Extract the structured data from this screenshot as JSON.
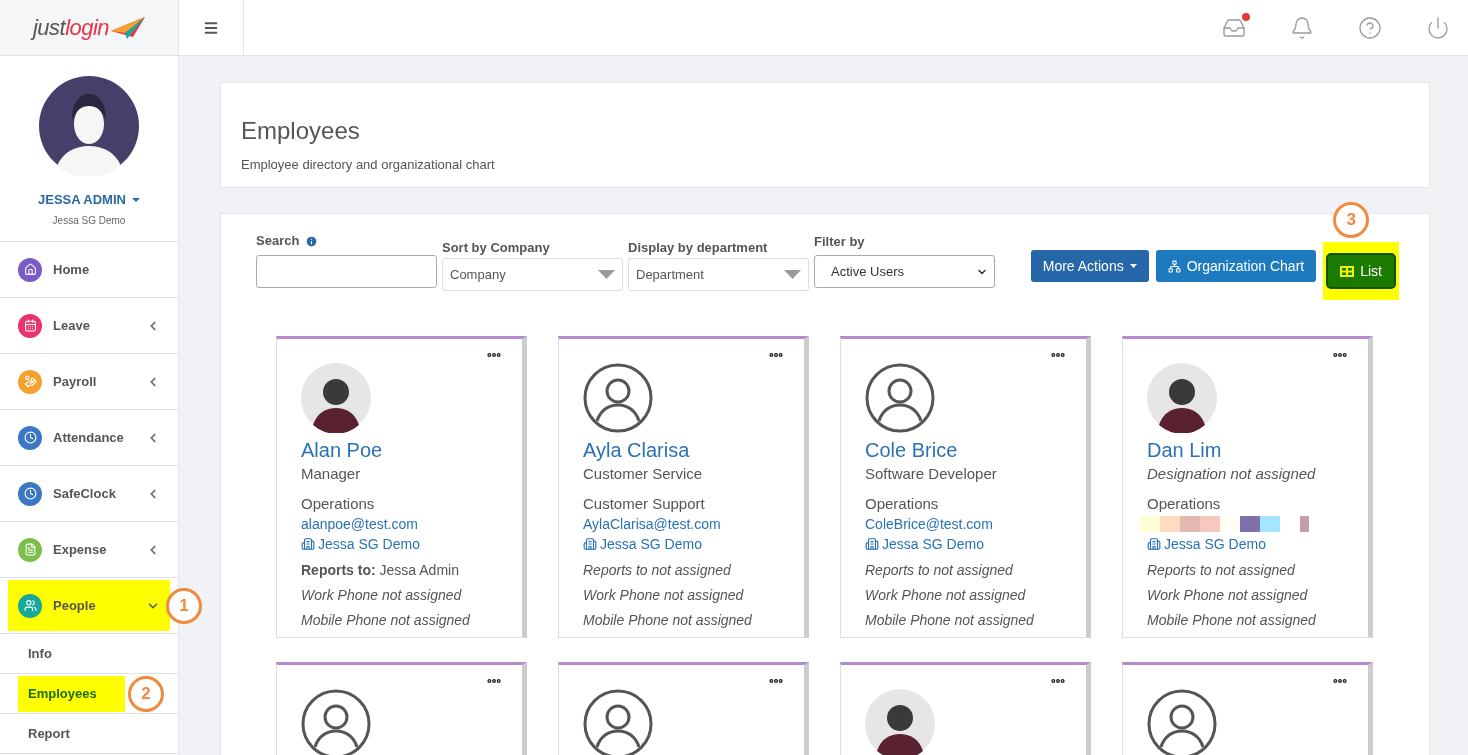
{
  "logo": {
    "part_1": "just",
    "part_2": "login"
  },
  "topbar": {
    "inbox_unread": true
  },
  "profile": {
    "name": "JESSA ADMIN",
    "company": "Jessa SG Demo"
  },
  "nav": [
    {
      "label": "Home",
      "color": "#7b5cc7",
      "expandable": false,
      "highlighted": false
    },
    {
      "label": "Leave",
      "color": "#e8336d",
      "expandable": true,
      "expanded": false,
      "highlighted": false
    },
    {
      "label": "Payroll",
      "color": "#f4a12d",
      "expandable": true,
      "expanded": false,
      "highlighted": false
    },
    {
      "label": "Attendance",
      "color": "#3a78c3",
      "expandable": true,
      "expanded": false,
      "highlighted": false
    },
    {
      "label": "SafeClock",
      "color": "#3a78c3",
      "expandable": true,
      "expanded": false,
      "highlighted": false
    },
    {
      "label": "Expense",
      "color": "#7cbf4a",
      "expandable": true,
      "expanded": false,
      "highlighted": false
    },
    {
      "label": "People",
      "color": "#19a99b",
      "expandable": true,
      "expanded": true,
      "highlighted": true,
      "callout": "1",
      "children": [
        {
          "label": "Info",
          "selected": false
        },
        {
          "label": "Employees",
          "selected": true,
          "callout": "2"
        },
        {
          "label": "Report",
          "selected": false
        }
      ]
    }
  ],
  "page": {
    "title": "Employees",
    "subtitle": "Employee directory and organizational chart"
  },
  "filters": {
    "search": {
      "label": "Search"
    },
    "sort": {
      "label": "Sort by Company",
      "value": "Company"
    },
    "department": {
      "label": "Display by department",
      "value": "Department"
    },
    "filter": {
      "label": "Filter by",
      "value": "Active Users"
    }
  },
  "actions": [
    {
      "label": "More Actions",
      "kind": "dropdown",
      "selected": false
    },
    {
      "label": "Organization Chart",
      "kind": "orgchart",
      "selected": false
    },
    {
      "label": "List",
      "kind": "list",
      "selected": true,
      "callout": "3"
    }
  ],
  "employees": [
    {
      "avatar": {
        "kind": "photo"
      },
      "name": "Alan Poe",
      "lines": [
        {
          "kind": "title",
          "text": "Manager",
          "italic": false
        },
        {
          "kind": "dept",
          "text": "Operations",
          "italic": false
        },
        {
          "kind": "email",
          "text": "alanpoe@test.com"
        },
        {
          "kind": "company",
          "text": "Jessa SG Demo"
        },
        {
          "kind": "plain",
          "text": "**Reports to:** Jessa Admin",
          "italic": false
        },
        {
          "kind": "plain",
          "text": "Work Phone not assigned",
          "italic": true
        },
        {
          "kind": "plain",
          "text": "Mobile Phone not assigned",
          "italic": true
        }
      ]
    },
    {
      "avatar": {
        "kind": "default"
      },
      "name": "Ayla Clarisa",
      "lines": [
        {
          "kind": "title",
          "text": "Customer Service",
          "italic": false
        },
        {
          "kind": "dept",
          "text": "Customer Support",
          "italic": false
        },
        {
          "kind": "email",
          "text": "AylaClarisa@test.com"
        },
        {
          "kind": "company",
          "text": "Jessa SG Demo"
        },
        {
          "kind": "plain",
          "text": "Reports to not assigned",
          "italic": true
        },
        {
          "kind": "plain",
          "text": "Work Phone not assigned",
          "italic": true
        },
        {
          "kind": "plain",
          "text": "Mobile Phone not assigned",
          "italic": true
        }
      ]
    },
    {
      "avatar": {
        "kind": "default"
      },
      "name": "Cole Brice",
      "lines": [
        {
          "kind": "title",
          "text": "Software Developer",
          "italic": false
        },
        {
          "kind": "dept",
          "text": "Operations",
          "italic": false
        },
        {
          "kind": "email",
          "text": "ColeBrice@test.com"
        },
        {
          "kind": "company",
          "text": "Jessa SG Demo"
        },
        {
          "kind": "plain",
          "text": "Reports to not assigned",
          "italic": true
        },
        {
          "kind": "plain",
          "text": "Work Phone not assigned",
          "italic": true
        },
        {
          "kind": "plain",
          "text": "Mobile Phone not assigned",
          "italic": true
        }
      ]
    },
    {
      "avatar": {
        "kind": "photo"
      },
      "name": "Dan Lim",
      "lines": [
        {
          "kind": "title",
          "text": "Designation not assigned",
          "italic": true
        },
        {
          "kind": "dept",
          "text": "Operations",
          "italic": false
        },
        {
          "kind": "redacted"
        },
        {
          "kind": "company",
          "text": "Jessa SG Demo"
        },
        {
          "kind": "plain",
          "text": "Reports to not assigned",
          "italic": true
        },
        {
          "kind": "plain",
          "text": "Work Phone not assigned",
          "italic": true
        },
        {
          "kind": "plain",
          "text": "Mobile Phone not assigned",
          "italic": true
        }
      ]
    },
    {
      "avatar": {
        "kind": "default"
      }
    },
    {
      "avatar": {
        "kind": "default"
      }
    },
    {
      "avatar": {
        "kind": "photo"
      }
    },
    {
      "avatar": {
        "kind": "default"
      }
    }
  ]
}
